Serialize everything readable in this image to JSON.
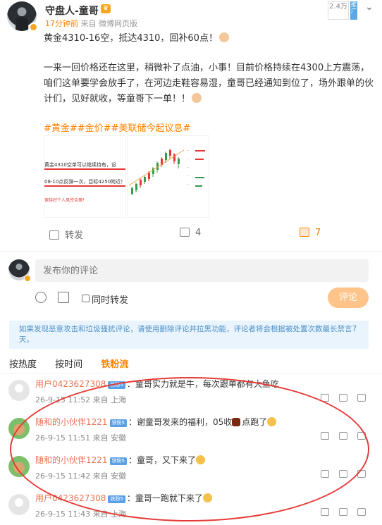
{
  "header": {
    "author": "守盘人-童哥",
    "time": "17分钟前",
    "source": "来自 微博网页版",
    "fans_count": "2.4万",
    "ad_label": "推广"
  },
  "post": {
    "line1": "黄金4310-16空，抵达4310，回补60点！",
    "para2": "一来一回价格还在这里，稍微补了点油，小事！目前价格持续在4300上方震荡，咱们这单要学会放手了，在河边走鞋容易湿，童哥已经通知到位了，场外跟单的伙计们，见好就收，等童哥下一单！！",
    "tags": "#黄金##金价##美联储今起议息#"
  },
  "image1": {
    "line_a": "黄金4310空单可以继续持有，设",
    "line_b": "08-10点反弹一次，目标4250附近！",
    "line_c": "保持好个人风控合理！"
  },
  "actions": {
    "repost": "转发",
    "comment_count": "4",
    "like_count": "7"
  },
  "composer": {
    "placeholder": "发布你的评论",
    "also_repost": "同时转发",
    "submit": "评论"
  },
  "notice": "如果发现恶意攻击和垃圾骚扰评论，请使用删除评论并拉黑功能，评论者将会根据被处置次数最长禁言7天。",
  "sort_tabs": [
    "按热度",
    "按时间",
    "铁粉流"
  ],
  "comments": [
    {
      "name": "用户0423627308",
      "badge": "铁粉5",
      "text": "：童哥实力就是牛，每次跟单都有大鱼吃",
      "when": "26-9-15 11:52 来自 上海"
    },
    {
      "name": "随和的小伙伴1221",
      "badge": "铁粉5",
      "text": "：谢童哥发来的福利，05收",
      "text2": "点跑了",
      "when": "26-9-15 11:51 来自 安徽"
    },
    {
      "name": "随和的小伙伴1221",
      "badge": "铁粉5",
      "text": "：童哥，又下来了",
      "when": "26-9-15 11:42 来自 安徽"
    },
    {
      "name": "用户0423627308",
      "badge": "铁粉5",
      "text": "：童哥一跑就下来了",
      "when": "26-9-15 11:43 来自 上海"
    }
  ],
  "colors": {
    "accent": "#ff8200",
    "link": "#eb7350",
    "annotation": "#e53935"
  }
}
